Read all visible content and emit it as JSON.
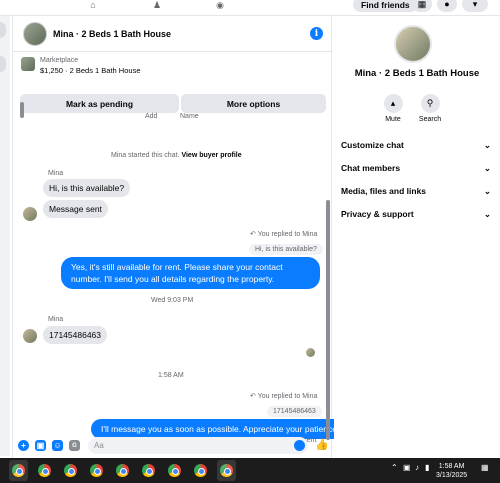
{
  "topbar": {
    "find_friends_label": "Find friends",
    "icons": [
      "marketplace-icon",
      "groups-icon",
      "gaming-icon",
      "menu-grid-icon",
      "notifications-icon",
      "account-icon"
    ]
  },
  "chat": {
    "title": "Mina · 2 Beds 1 Bath House",
    "marketplace": {
      "label": "Marketplace",
      "listing": "$1,250 · 2 Beds 1 Bath House",
      "mark_pending_label": "Mark as pending",
      "more_options_label": "More options"
    },
    "header_hint": {
      "add": "Add",
      "name": "Name"
    },
    "started_notice": "Mina started this chat.",
    "view_profile_label": "View buyer profile",
    "messages": {
      "sender1": "Mina",
      "msg1": "Hi, is this available?",
      "msg2": "Message sent",
      "replied1": "You replied to Mina",
      "quote1": "Hi, is this available?",
      "reply1": "Yes, it's still available for rent. Please share your contact number. I'll send you all details regarding the property.",
      "time1": "Wed 9:03 PM",
      "sender2": "Mina",
      "msg3": "17145486463",
      "time2": "1:58 AM",
      "replied2": "You replied to Mina",
      "quote2": "17145486463",
      "reply2": "I'll message you as soon as possible. Appreciate your patience",
      "status": "Sent"
    },
    "composer": {
      "placeholder": "Aa"
    }
  },
  "right_panel": {
    "title": "Mina · 2 Beds 1 Bath House",
    "mute_label": "Mute",
    "search_label": "Search",
    "sections": [
      "Customize chat",
      "Chat members",
      "Media, files and links",
      "Privacy & support"
    ]
  },
  "taskbar": {
    "time": "1:58 AM",
    "date": "3/13/2025"
  },
  "colors": {
    "accent": "#0a7cff",
    "bubble_incoming": "#e4e6eb",
    "taskbar": "#1c1c1c"
  }
}
